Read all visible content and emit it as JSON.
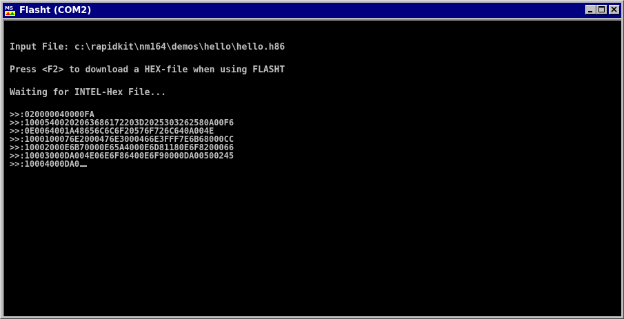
{
  "window": {
    "title": "Flasht (COM2)",
    "app_icon": "ms-dos-icon",
    "buttons": {
      "minimize_icon": "minimize-icon",
      "maximize_icon": "maximize-icon",
      "close_icon": "close-icon"
    }
  },
  "console": {
    "lines": [
      "Input File: c:\\rapidkit\\nm164\\demos\\hello\\hello.h86",
      "Press <F2> to download a HEX-file when using FLASHT",
      "Waiting for INTEL-Hex File..."
    ],
    "hex_records": [
      ">>:020000040000FA",
      ">>:10005400202063686172203D2025303262580A00F6",
      ">>:0E0064001A48656C6C6F20576F726C640A004E",
      ">>:1000100076E2000476E3000466E3FFF7E6B68000CC",
      ">>:10002000E6B70000E65A4000E6D81180E6F8200066",
      ">>:10003000DA004E06E6F86400E6F90000DA00500245",
      ">>:10004000DA0"
    ]
  },
  "colors": {
    "title_bar": "#000080",
    "console_bg": "#000000",
    "console_text": "#c0c0c0"
  }
}
